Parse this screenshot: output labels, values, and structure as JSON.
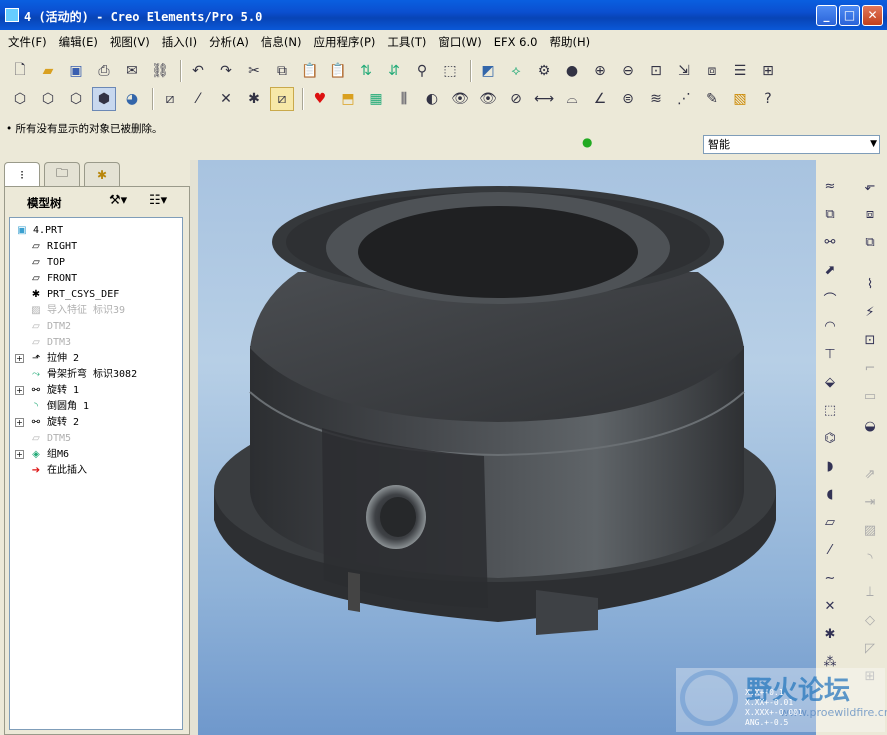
{
  "window": {
    "title": "4 (活动的) - Creo Elements/Pro 5.0"
  },
  "window_controls": {
    "minimize": "_",
    "maximize": "□",
    "close": "✕"
  },
  "menu": [
    "文件(F)",
    "编辑(E)",
    "视图(V)",
    "插入(I)",
    "分析(A)",
    "信息(N)",
    "应用程序(P)",
    "工具(T)",
    "窗口(W)",
    "EFX 6.0",
    "帮助(H)"
  ],
  "message": "所有没有显示的对象已被删除。",
  "selection_filter": {
    "value": "智能"
  },
  "model_tree": {
    "header": "模型树",
    "items": [
      {
        "icon": "part-icon",
        "label": "4.PRT",
        "dim": false,
        "expand": false
      },
      {
        "icon": "datum-plane-icon",
        "label": "RIGHT",
        "dim": false,
        "expand": false
      },
      {
        "icon": "datum-plane-icon",
        "label": "TOP",
        "dim": false,
        "expand": false
      },
      {
        "icon": "datum-plane-icon",
        "label": "FRONT",
        "dim": false,
        "expand": false
      },
      {
        "icon": "csys-icon",
        "label": "PRT_CSYS_DEF",
        "dim": false,
        "expand": false
      },
      {
        "icon": "import-feature-icon",
        "label": "导入特征 标识39",
        "dim": true,
        "expand": false
      },
      {
        "icon": "datum-plane-icon",
        "label": "DTM2",
        "dim": true,
        "expand": false
      },
      {
        "icon": "datum-plane-icon",
        "label": "DTM3",
        "dim": true,
        "expand": false
      },
      {
        "icon": "extrude-icon",
        "label": "拉伸 2",
        "dim": false,
        "expand": true
      },
      {
        "icon": "skeleton-bend-icon",
        "label": "骨架折弯 标识3082",
        "dim": false,
        "expand": false
      },
      {
        "icon": "revolve-icon",
        "label": "旋转 1",
        "dim": false,
        "expand": true
      },
      {
        "icon": "round-icon",
        "label": "倒圆角 1",
        "dim": false,
        "expand": false
      },
      {
        "icon": "revolve-icon",
        "label": "旋转 2",
        "dim": false,
        "expand": true
      },
      {
        "icon": "datum-plane-icon",
        "label": "DTM5",
        "dim": true,
        "expand": false
      },
      {
        "icon": "group-icon",
        "label": "组M6",
        "dim": false,
        "expand": true
      },
      {
        "icon": "insert-here-icon",
        "label": "在此插入",
        "dim": false,
        "expand": false
      }
    ]
  },
  "watermark": {
    "brand": "野火论坛",
    "url": "www.proewildfire.cn"
  },
  "tolerance_text": "X.X+-0.1\nX.XX+-0.01\nX.XXX+-0.001\nANG.+-0.5",
  "colors": {
    "titlebar": "#0b4fd0",
    "viewport_top": "#a8c3e0",
    "viewport_bottom": "#6f98cc",
    "model": "#3c3e42"
  }
}
